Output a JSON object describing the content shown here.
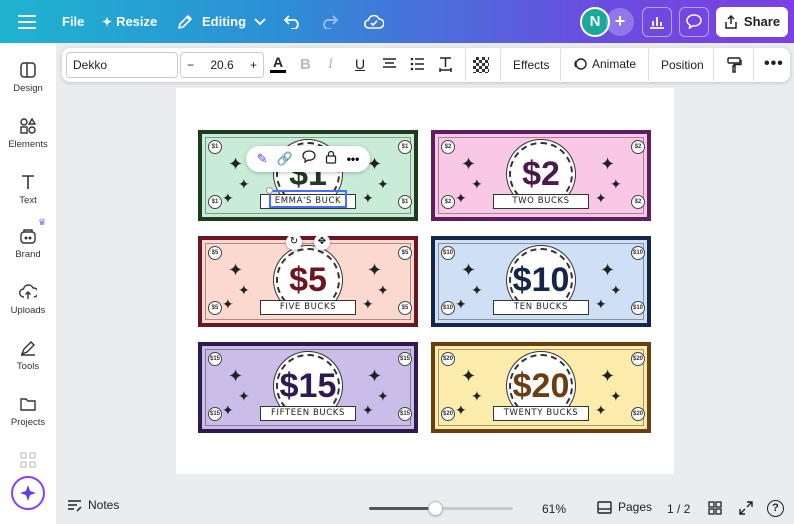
{
  "topbar": {
    "file_label": "File",
    "resize_label": "Resize",
    "editing_label": "Editing",
    "avatar_initial": "N",
    "share_label": "Share"
  },
  "toolbar": {
    "font_name": "Dekko",
    "font_size": "20.6",
    "minus_label": "−",
    "plus_label": "+",
    "effects_label": "Effects",
    "animate_label": "Animate",
    "position_label": "Position"
  },
  "sidebar": {
    "items": [
      {
        "label": "Design",
        "icon": "layout-icon"
      },
      {
        "label": "Elements",
        "icon": "shapes-icon"
      },
      {
        "label": "Text",
        "icon": "text-icon"
      },
      {
        "label": "Brand",
        "icon": "brand-icon"
      },
      {
        "label": "Uploads",
        "icon": "upload-cloud-icon"
      },
      {
        "label": "Tools",
        "icon": "pen-tool-icon"
      },
      {
        "label": "Projects",
        "icon": "folder-icon"
      }
    ]
  },
  "bills": [
    {
      "amount": "$1",
      "corner": "$1",
      "label": "EMMA'S BUCK",
      "bg": "#c9ecd7",
      "border": "#1e3b1e",
      "color": "#1e3b1e"
    },
    {
      "amount": "$2",
      "corner": "$2",
      "label": "TWO BUCKS",
      "bg": "#f9c8e7",
      "border": "#5d1f5d",
      "color": "#4a1a4a"
    },
    {
      "amount": "$5",
      "corner": "$5",
      "label": "FIVE BUCKS",
      "bg": "#fcd9cf",
      "border": "#6b1622",
      "color": "#6b1622"
    },
    {
      "amount": "$10",
      "corner": "$10",
      "label": "TEN BUCKS",
      "bg": "#cfe0f6",
      "border": "#14264a",
      "color": "#14264a"
    },
    {
      "amount": "$15",
      "corner": "$15",
      "label": "FIFTEEN BUCKS",
      "bg": "#cbbde9",
      "border": "#2e1a4d",
      "color": "#2e1a4d"
    },
    {
      "amount": "$20",
      "corner": "$20",
      "label": "TWENTY BUCKS",
      "bg": "#fbecac",
      "border": "#6b3e12",
      "color": "#6b3e12"
    }
  ],
  "bottom": {
    "notes_label": "Notes",
    "zoom_value": "61%",
    "zoom_fraction": 0.46,
    "pages_label": "Pages",
    "page_counter": "1 / 2",
    "help_label": "?"
  },
  "colors": {
    "accent": "#8b3dff",
    "selection": "#4b6bfb"
  }
}
